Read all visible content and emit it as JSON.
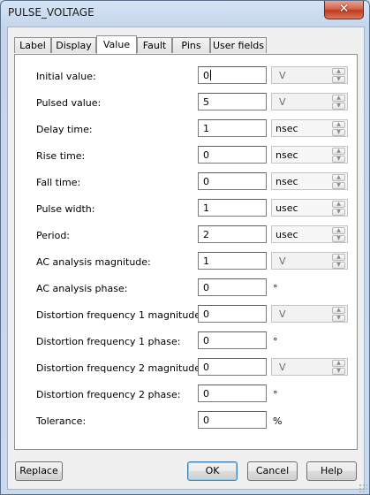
{
  "window": {
    "title": "PULSE_VOLTAGE",
    "close_glyph": "✕"
  },
  "tabs": [
    "Label",
    "Display",
    "Value",
    "Fault",
    "Pins",
    "User fields"
  ],
  "active_tab": "Value",
  "fields": [
    {
      "label": "Initial value:",
      "value": "0",
      "unit": "V",
      "unit_type": "combo"
    },
    {
      "label": "Pulsed value:",
      "value": "5",
      "unit": "V",
      "unit_type": "combo"
    },
    {
      "label": "Delay time:",
      "value": "1",
      "unit": "nsec",
      "unit_type": "combo-enabled"
    },
    {
      "label": "Rise time:",
      "value": "0",
      "unit": "nsec",
      "unit_type": "combo-enabled"
    },
    {
      "label": "Fall time:",
      "value": "0",
      "unit": "nsec",
      "unit_type": "combo-enabled"
    },
    {
      "label": "Pulse width:",
      "value": "1",
      "unit": "usec",
      "unit_type": "combo-enabled"
    },
    {
      "label": "Period:",
      "value": "2",
      "unit": "usec",
      "unit_type": "combo-enabled"
    },
    {
      "label": "AC analysis magnitude:",
      "value": "1",
      "unit": "V",
      "unit_type": "combo"
    },
    {
      "label": "AC analysis phase:",
      "value": "0",
      "unit": "°",
      "unit_type": "plain"
    },
    {
      "label": "Distortion frequency 1 magnitude:",
      "value": "0",
      "unit": "V",
      "unit_type": "combo"
    },
    {
      "label": "Distortion frequency 1 phase:",
      "value": "0",
      "unit": "°",
      "unit_type": "plain"
    },
    {
      "label": "Distortion frequency 2 magnitude:",
      "value": "0",
      "unit": "V",
      "unit_type": "combo"
    },
    {
      "label": "Distortion frequency 2 phase:",
      "value": "0",
      "unit": "°",
      "unit_type": "plain"
    },
    {
      "label": "Tolerance:",
      "value": "0",
      "unit": "%",
      "unit_type": "plain"
    }
  ],
  "buttons": {
    "replace": "Replace",
    "ok": "OK",
    "cancel": "Cancel",
    "help": "Help"
  },
  "spin_up": "▲",
  "spin_down": "▼"
}
